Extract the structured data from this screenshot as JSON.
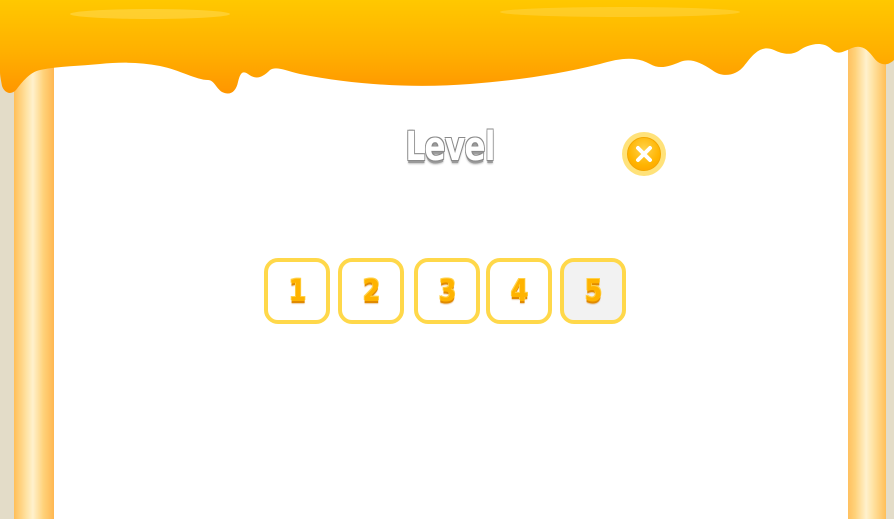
{
  "screen": {
    "title": "Level",
    "close_icon": "close-icon"
  },
  "levels": [
    {
      "label": "1",
      "selected": false
    },
    {
      "label": "2",
      "selected": false
    },
    {
      "label": "3",
      "selected": false
    },
    {
      "label": "4",
      "selected": false
    },
    {
      "label": "5",
      "selected": true
    }
  ],
  "colors": {
    "drip": "#ffb000",
    "button_border": "#ffd84a",
    "number": "#ffb300",
    "background": "#e3dcc8"
  }
}
